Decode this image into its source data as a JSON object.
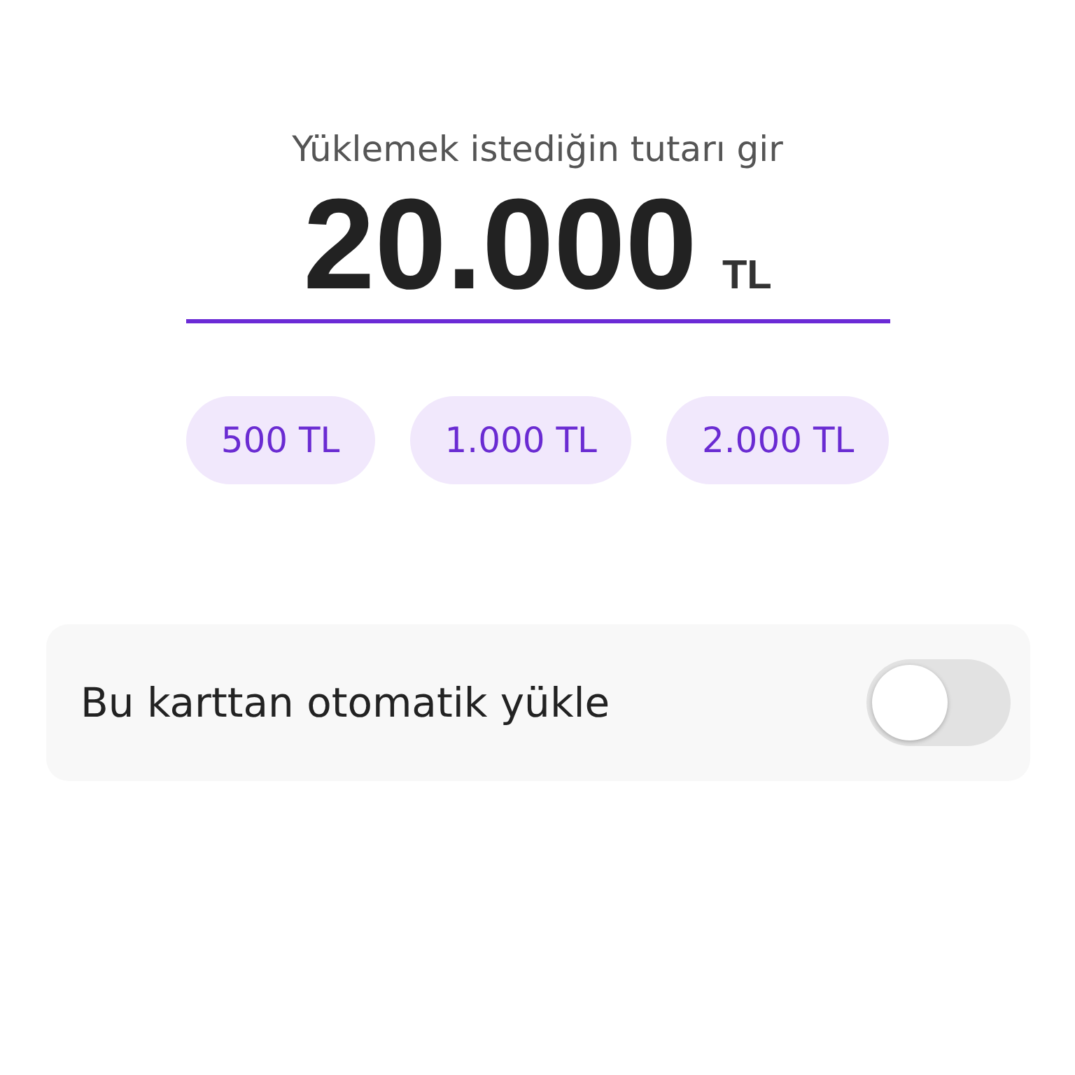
{
  "prompt": "Yüklemek istediğin tutarı gir",
  "amount": {
    "value": "20.000",
    "currency": "TL"
  },
  "quick_amounts": [
    {
      "label": "500 TL"
    },
    {
      "label": "1.000 TL"
    },
    {
      "label": "2.000 TL"
    }
  ],
  "auto_load": {
    "label": "Bu karttan otomatik yükle",
    "on": false
  }
}
